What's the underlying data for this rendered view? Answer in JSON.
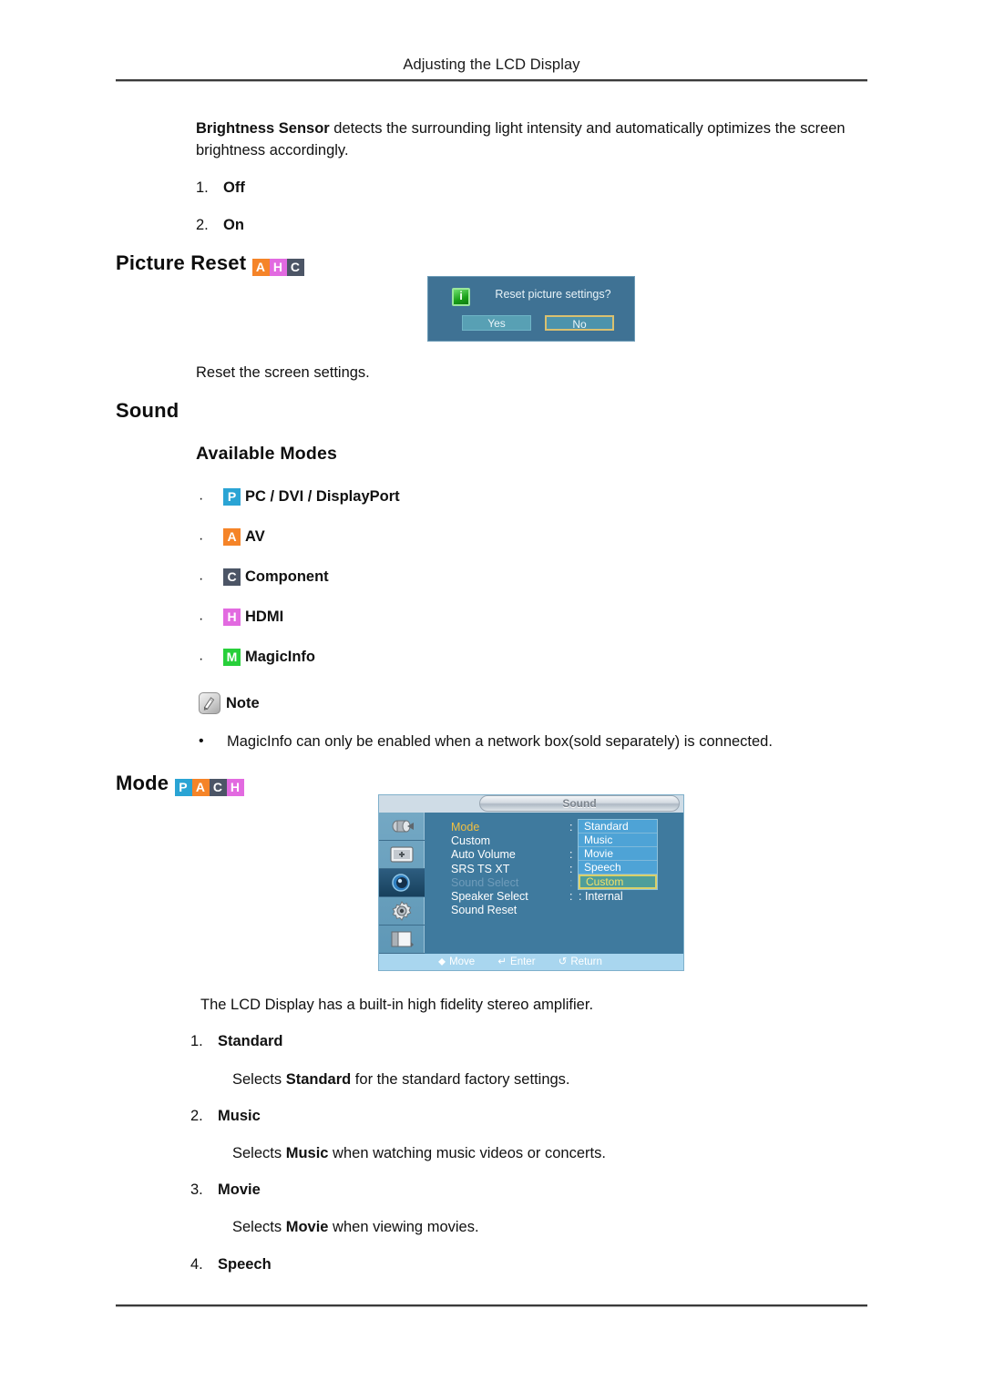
{
  "page": {
    "header_title": "Adjusting the LCD Display"
  },
  "brightness_sensor": {
    "bold_lead": "Brightness Sensor",
    "body": " detects the surrounding light intensity and automatically optimizes the screen brightness accordingly.",
    "items": [
      {
        "num": "1.",
        "label": "Off"
      },
      {
        "num": "2.",
        "label": "On"
      }
    ]
  },
  "picture_reset": {
    "heading": "Picture Reset",
    "tags": [
      "A",
      "H",
      "C"
    ],
    "caption": "Reset the screen settings.",
    "dialog": {
      "icon": "info-icon",
      "icon_glyph": "i",
      "message": "Reset picture settings?",
      "yes_label": "Yes",
      "no_label": "No",
      "bg_color": "#3f7294",
      "button_color": "#58a0b4",
      "focus_border_color": "#d9c070"
    }
  },
  "sound": {
    "heading": "Sound",
    "available_modes": {
      "heading": "Available Modes",
      "items": [
        {
          "tag": "P",
          "label": "PC / DVI / DisplayPort"
        },
        {
          "tag": "A",
          "label": "AV"
        },
        {
          "tag": "C",
          "label": "Component"
        },
        {
          "tag": "H",
          "label": "HDMI"
        },
        {
          "tag": "M",
          "label": "MagicInfo"
        }
      ]
    },
    "note": {
      "icon": "note-pencil-icon",
      "label": "Note",
      "bullets": [
        "MagicInfo can only be enabled when a network box(sold separately) is connected."
      ]
    }
  },
  "mode": {
    "heading": "Mode",
    "tags": [
      "P",
      "A",
      "C",
      "H"
    ],
    "description": "The LCD Display has a built-in high fidelity stereo amplifier.",
    "items": [
      {
        "num": "1.",
        "label": "Standard",
        "desc_pre": "Selects ",
        "desc_bold": "Standard",
        "desc_post": " for the standard factory settings."
      },
      {
        "num": "2.",
        "label": "Music",
        "desc_pre": "Selects ",
        "desc_bold": "Music",
        "desc_post": " when watching music videos or concerts."
      },
      {
        "num": "3.",
        "label": "Movie",
        "desc_pre": "Selects ",
        "desc_bold": "Movie",
        "desc_post": " when viewing movies."
      },
      {
        "num": "4.",
        "label": "Speech",
        "desc_pre": "",
        "desc_bold": "",
        "desc_post": ""
      }
    ],
    "osd": {
      "title": "Sound",
      "sidebar_icons": [
        "input-source-icon",
        "picture-icon",
        "sound-speaker-icon",
        "setup-gear-icon",
        "multi-control-icon"
      ],
      "active_sidebar_index": 2,
      "menu_items": [
        {
          "label": "Mode",
          "state": "selected",
          "colon": true
        },
        {
          "label": "Custom",
          "state": "normal",
          "colon": false
        },
        {
          "label": "Auto Volume",
          "state": "normal",
          "colon": true
        },
        {
          "label": "SRS TS XT",
          "state": "normal",
          "colon": true
        },
        {
          "label": "Sound Select",
          "state": "disabled",
          "colon": true
        },
        {
          "label": "Speaker Select",
          "state": "normal",
          "colon": true
        },
        {
          "label": "Sound Reset",
          "state": "normal",
          "colon": false
        }
      ],
      "speaker_select_value": ": Internal",
      "submenu_items": [
        {
          "label": "Standard",
          "highlight": false
        },
        {
          "label": "Music",
          "highlight": false
        },
        {
          "label": "Movie",
          "highlight": false
        },
        {
          "label": "Speech",
          "highlight": false
        },
        {
          "label": "Custom",
          "highlight": true
        }
      ],
      "footer": [
        {
          "glyph": "⬥",
          "label": "Move"
        },
        {
          "glyph": "↵",
          "label": "Enter"
        },
        {
          "glyph": "↺",
          "label": "Return"
        }
      ],
      "colors": {
        "panel_bg": "#3f7a9e",
        "submenu_bg": "#4ea3d6",
        "selected_text": "#f2c041",
        "disabled_text": "#6f9cba",
        "highlight_bg": "#4f9e9a",
        "highlight_border": "#d9d06a",
        "footer_bg": "#a9d6ef"
      }
    }
  },
  "tag_colors": {
    "P": "#2aa4d4",
    "A": "#f58428",
    "C": "#4c5566",
    "H": "#e26ae0",
    "M": "#27cf3a"
  }
}
